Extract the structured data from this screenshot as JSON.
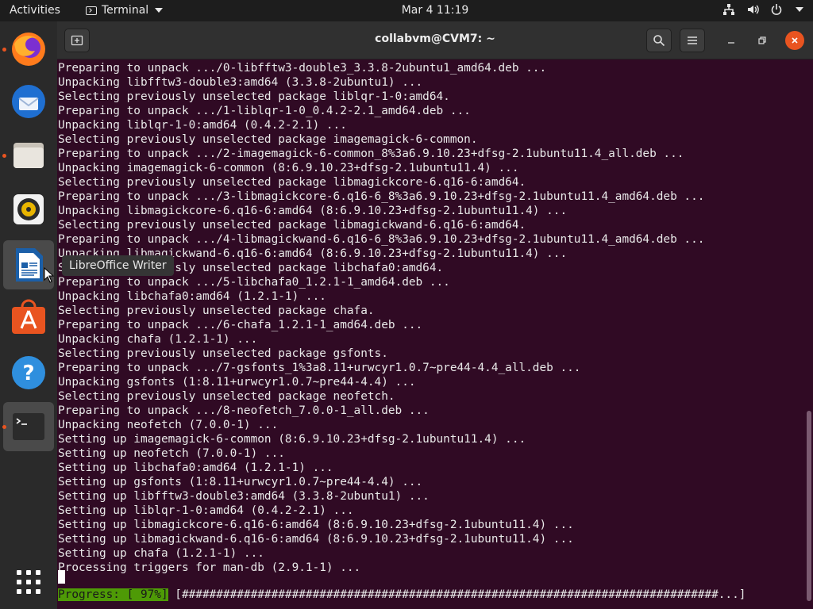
{
  "topbar": {
    "activities": "Activities",
    "app_name": "Terminal",
    "clock": "Mar 4  11:19"
  },
  "dock": {
    "tooltip": "LibreOffice Writer",
    "items": [
      {
        "name": "firefox",
        "running": true
      },
      {
        "name": "thunderbird",
        "running": false
      },
      {
        "name": "files",
        "running": true
      },
      {
        "name": "rhythmbox",
        "running": false
      },
      {
        "name": "libreoffice-writer",
        "running": false
      },
      {
        "name": "ubuntu-software",
        "running": false
      },
      {
        "name": "help",
        "running": false
      },
      {
        "name": "terminal",
        "running": true
      }
    ]
  },
  "window": {
    "title": "collabvm@CVM7: ~"
  },
  "terminal": {
    "lines": [
      "Preparing to unpack .../0-libfftw3-double3_3.3.8-2ubuntu1_amd64.deb ...",
      "Unpacking libfftw3-double3:amd64 (3.3.8-2ubuntu1) ...",
      "Selecting previously unselected package liblqr-1-0:amd64.",
      "Preparing to unpack .../1-liblqr-1-0_0.4.2-2.1_amd64.deb ...",
      "Unpacking liblqr-1-0:amd64 (0.4.2-2.1) ...",
      "Selecting previously unselected package imagemagick-6-common.",
      "Preparing to unpack .../2-imagemagick-6-common_8%3a6.9.10.23+dfsg-2.1ubuntu11.4_all.deb ...",
      "Unpacking imagemagick-6-common (8:6.9.10.23+dfsg-2.1ubuntu11.4) ...",
      "Selecting previously unselected package libmagickcore-6.q16-6:amd64.",
      "Preparing to unpack .../3-libmagickcore-6.q16-6_8%3a6.9.10.23+dfsg-2.1ubuntu11.4_amd64.deb ...",
      "Unpacking libmagickcore-6.q16-6:amd64 (8:6.9.10.23+dfsg-2.1ubuntu11.4) ...",
      "Selecting previously unselected package libmagickwand-6.q16-6:amd64.",
      "Preparing to unpack .../4-libmagickwand-6.q16-6_8%3a6.9.10.23+dfsg-2.1ubuntu11.4_amd64.deb ...",
      "Unpacking libmagickwand-6.q16-6:amd64 (8:6.9.10.23+dfsg-2.1ubuntu11.4) ...",
      "Selecting previously unselected package libchafa0:amd64.",
      "Preparing to unpack .../5-libchafa0_1.2.1-1_amd64.deb ...",
      "Unpacking libchafa0:amd64 (1.2.1-1) ...",
      "Selecting previously unselected package chafa.",
      "Preparing to unpack .../6-chafa_1.2.1-1_amd64.deb ...",
      "Unpacking chafa (1.2.1-1) ...",
      "Selecting previously unselected package gsfonts.",
      "Preparing to unpack .../7-gsfonts_1%3a8.11+urwcyr1.0.7~pre44-4.4_all.deb ...",
      "Unpacking gsfonts (1:8.11+urwcyr1.0.7~pre44-4.4) ...",
      "Selecting previously unselected package neofetch.",
      "Preparing to unpack .../8-neofetch_7.0.0-1_all.deb ...",
      "Unpacking neofetch (7.0.0-1) ...",
      "Setting up imagemagick-6-common (8:6.9.10.23+dfsg-2.1ubuntu11.4) ...",
      "Setting up neofetch (7.0.0-1) ...",
      "Setting up libchafa0:amd64 (1.2.1-1) ...",
      "Setting up gsfonts (1:8.11+urwcyr1.0.7~pre44-4.4) ...",
      "Setting up libfftw3-double3:amd64 (3.3.8-2ubuntu1) ...",
      "Setting up liblqr-1-0:amd64 (0.4.2-2.1) ...",
      "Setting up libmagickcore-6.q16-6:amd64 (8:6.9.10.23+dfsg-2.1ubuntu11.4) ...",
      "Setting up libmagickwand-6.q16-6:amd64 (8:6.9.10.23+dfsg-2.1ubuntu11.4) ...",
      "Setting up chafa (1.2.1-1) ...",
      "Processing triggers for man-db (2.9.1-1) ..."
    ],
    "progress_label": "Progress: [ 97%]",
    "progress_bar": " [##############################################################################...]",
    "progress_percent": 97
  },
  "colors": {
    "terminal_bg": "#300a24",
    "accent": "#e95420",
    "progress_label_bg": "#4e9a06"
  }
}
